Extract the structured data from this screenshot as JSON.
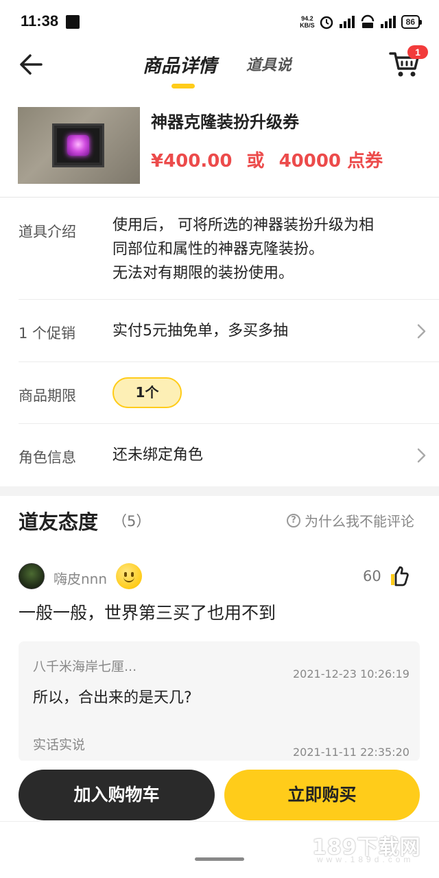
{
  "status_bar": {
    "time": "11:38",
    "net_speed_top": "94.2",
    "net_speed_bottom": "KB/S",
    "battery": "86"
  },
  "header": {
    "tab_active": "商品详情",
    "tab_other": "道具说",
    "cart_badge": "1"
  },
  "product": {
    "name": "神器克隆装扮升级券",
    "price": "¥400.00",
    "or": "或",
    "points": "40000 点券"
  },
  "info": {
    "intro_label": "道具介绍",
    "intro_line1": "使用后， 可将所选的神器装扮升级为相",
    "intro_line2": "同部位和属性的神器克隆装扮。",
    "intro_line3": "无法对有期限的装扮使用。",
    "promo_label": "1 个促销",
    "promo_text": "实付5元抽免单，多买多抽",
    "limit_label": "商品期限",
    "limit_value": "1个",
    "role_label": "角色信息",
    "role_value": "还未绑定角色"
  },
  "reviews": {
    "title": "道友态度",
    "count": "（5）",
    "help_text": "为什么我不能评论",
    "help_icon_glyph": "?",
    "item": {
      "username": "嗨皮nnn",
      "likes": "60",
      "text": "一般一般，世界第三买了也用不到"
    },
    "replies": [
      {
        "user": "八千米海岸七厘...",
        "date": "2021-12-23 10:26:19",
        "text": "所以，合出来的是天几?"
      },
      {
        "user": "实话实说",
        "date": "2021-11-11 22:35:20",
        "text": ""
      }
    ]
  },
  "actions": {
    "add_to_cart": "加入购物车",
    "buy_now": "立即购买"
  },
  "watermark": {
    "main": "189下载网",
    "sub": "www.189d.com"
  },
  "colors": {
    "accent_yellow": "#ffcc1a",
    "price_red": "#ec4b4b",
    "badge_red": "#f23b3b",
    "dark_button": "#2a2a2a"
  }
}
